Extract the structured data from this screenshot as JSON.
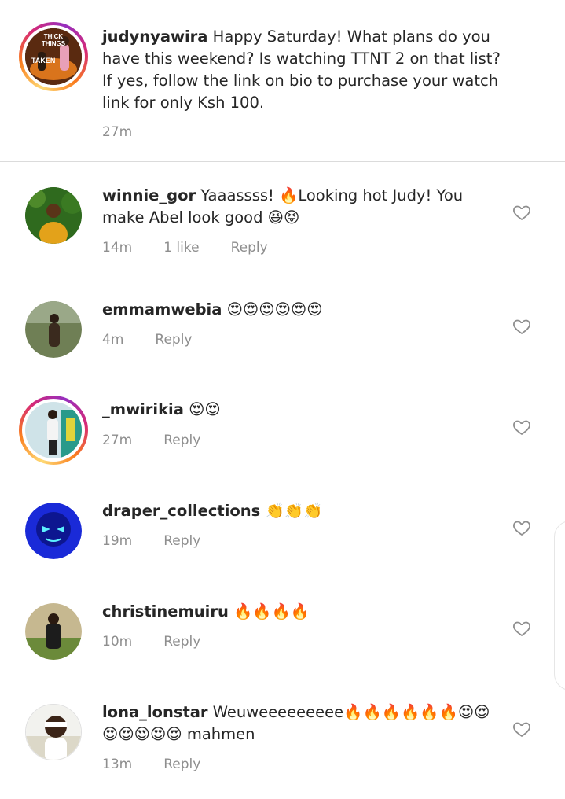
{
  "caption": {
    "username": "judynyawira",
    "text": "Happy Saturday! What plans do you have this weekend? Is watching TTNT 2 on that list? If yes, follow the link on bio to purchase your watch link for only Ksh 100.",
    "time": "27m",
    "poster_text_top": "THICK THINGS",
    "poster_text_bottom": "TAKEN"
  },
  "comments": [
    {
      "username": "winnie_gor",
      "text": "Yaaassss! 🔥Looking hot Judy! You make Abel look good 😆😝",
      "time": "14m",
      "likes": "1 like",
      "reply": "Reply"
    },
    {
      "username": "emmamwebia",
      "text": "😍😍😍😍😍😍",
      "time": "4m",
      "reply": "Reply"
    },
    {
      "username": "_mwirikia",
      "text": "😍😍",
      "time": "27m",
      "reply": "Reply"
    },
    {
      "username": "draper_collections",
      "text": "👏👏👏",
      "time": "19m",
      "reply": "Reply"
    },
    {
      "username": "christinemuiru",
      "text": "🔥🔥🔥🔥",
      "time": "10m",
      "reply": "Reply"
    },
    {
      "username": "lona_lonstar",
      "text": "Weuweeeeeeeee🔥🔥🔥🔥🔥🔥😍😍😍😍😍😍😍 mahmen",
      "time": "13m",
      "reply": "Reply"
    }
  ],
  "colors": {
    "text": "#262626",
    "meta": "#8e8e8e",
    "divider": "#dbdbdb",
    "heart_stroke": "#8e8e8e"
  },
  "icons": {
    "like": "heart-outline-icon"
  }
}
